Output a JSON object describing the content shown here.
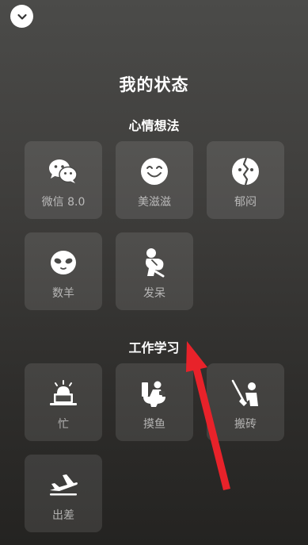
{
  "page_title": "我的状态",
  "sections": [
    {
      "title": "心情想法",
      "items": [
        {
          "label": "微信 8.0",
          "icon": "wechat-bubbles-icon"
        },
        {
          "label": "美滋滋",
          "icon": "smiling-face-icon"
        },
        {
          "label": "郁闷",
          "icon": "cracked-face-icon"
        },
        {
          "label": "数羊",
          "icon": "sheep-face-icon"
        },
        {
          "label": "发呆",
          "icon": "thinker-icon"
        }
      ]
    },
    {
      "title": "工作学习",
      "items": [
        {
          "label": "忙",
          "icon": "siren-laptop-icon"
        },
        {
          "label": "摸鱼",
          "icon": "toilet-icon"
        },
        {
          "label": "搬砖",
          "icon": "worker-shovel-icon"
        },
        {
          "label": "出差",
          "icon": "airplane-icon"
        }
      ]
    }
  ],
  "colors": {
    "arrow": "#e8222a",
    "tile_bg": "rgba(255,255,255,0.10)",
    "label": "rgba(255,255,255,0.60)"
  }
}
